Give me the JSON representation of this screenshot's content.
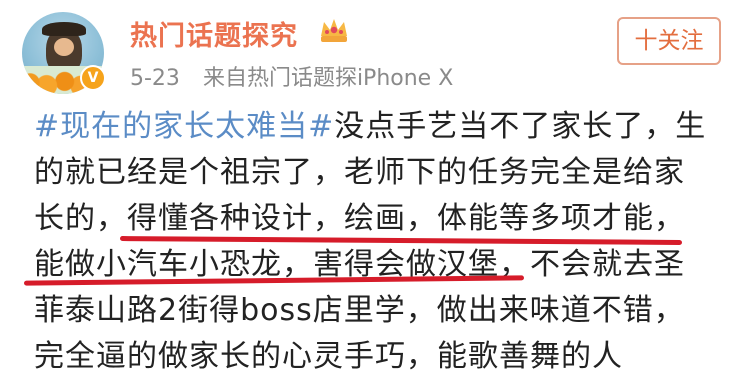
{
  "post_header": {
    "username": "热门话题探究",
    "date": "5-23",
    "source": "来自热门话题探iPhone X",
    "follow_label": "十关注",
    "crown_icon": "crown-icon",
    "verified_icon": "verified-v-icon"
  },
  "post_body": {
    "hashtag": "#现在的家长太难当#",
    "lines": [
      "没点手艺当不了家长了，生",
      "的就已经是个祖宗了，老师下的任务完全是给家",
      "长的，得懂各种设计，绘画，体能等多项才能，",
      "能做小汽车小恐龙，害得会做汉堡，不会就去圣",
      "菲泰山路2街得boss店里学，做出来味道不错，",
      "完全逼的做家长的心灵手巧，能歌善舞的人"
    ]
  },
  "colors": {
    "username": "#eb7350",
    "hashtag": "#5b8cc6",
    "underline": "#d61c2a",
    "meta": "#8a8a8a"
  }
}
